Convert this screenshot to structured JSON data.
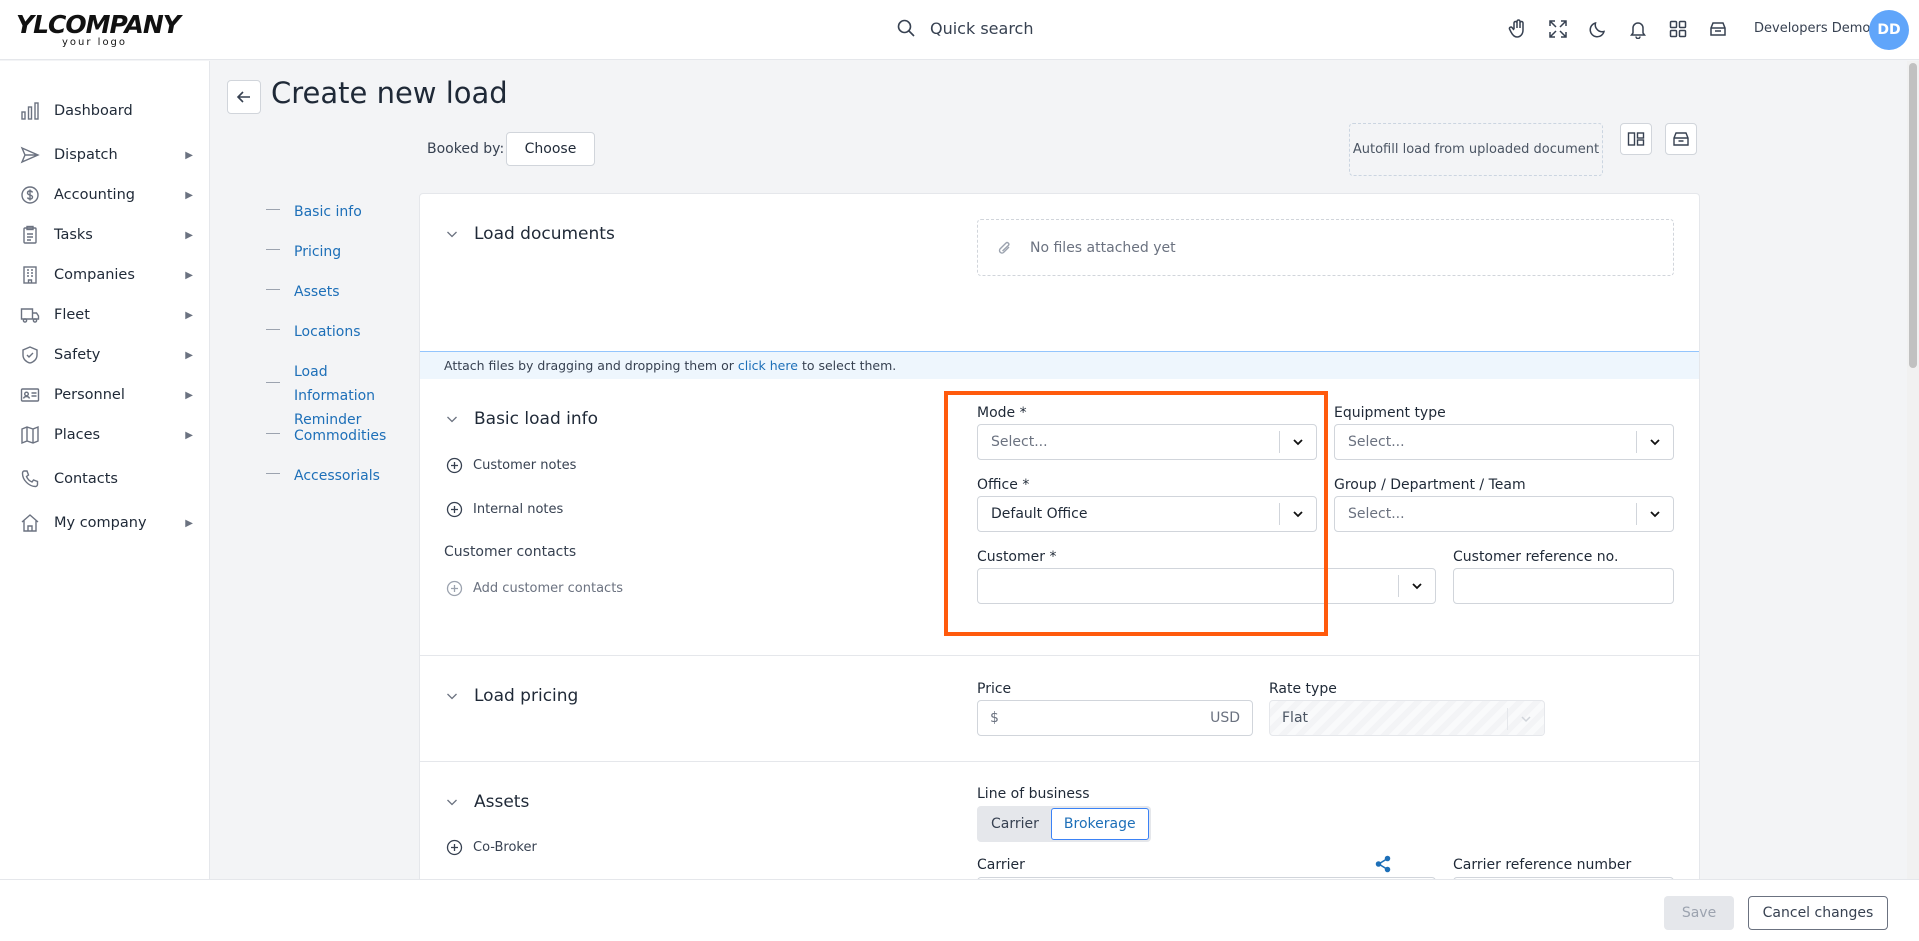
{
  "brand": {
    "logo_main": "YLCOMPANY",
    "logo_sub": "your logo"
  },
  "topbar": {
    "search_label": "Quick search",
    "user_name": "Developers Demo",
    "avatar_initials": "DD",
    "icons": [
      "hand-icon",
      "fullscreen-icon",
      "moon-icon",
      "bell-icon",
      "apps-grid-icon",
      "archive-icon"
    ]
  },
  "sidebar": {
    "items": [
      {
        "label": "Dashboard",
        "icon": "chart-icon",
        "arrow": ""
      },
      {
        "label": "Dispatch",
        "icon": "send-icon",
        "arrow": "▶"
      },
      {
        "label": "Accounting",
        "icon": "dollar-icon",
        "arrow": "▶"
      },
      {
        "label": "Tasks",
        "icon": "clipboard-icon",
        "arrow": "▶"
      },
      {
        "label": "Companies",
        "icon": "building-icon",
        "arrow": "▶"
      },
      {
        "label": "Fleet",
        "icon": "truck-icon",
        "arrow": "▶"
      },
      {
        "label": "Safety",
        "icon": "shield-icon",
        "arrow": "▶"
      },
      {
        "label": "Personnel",
        "icon": "id-card-icon",
        "arrow": "▶"
      },
      {
        "label": "Places",
        "icon": "map-icon",
        "arrow": "▶"
      },
      {
        "label": "Contacts",
        "icon": "phone-icon",
        "arrow": ""
      },
      {
        "label": "My company",
        "icon": "home-icon",
        "arrow": "▶"
      }
    ]
  },
  "page": {
    "title": "Create new load",
    "booked_by_label": "Booked by:",
    "choose_label": "Choose",
    "autofill_label": "Autofill load from uploaded document"
  },
  "anchors": [
    "Basic info",
    "Pricing",
    "Assets",
    "Locations",
    "Load Information Reminder",
    "Commodities",
    "Accessorials"
  ],
  "sections": {
    "documents": {
      "title": "Load documents",
      "no_files": "No files attached yet",
      "attach_prefix": "Attach files by dragging and dropping them or",
      "attach_link": "click here",
      "attach_suffix": "to select them."
    },
    "basic": {
      "title": "Basic load info",
      "customer_notes": "Customer notes",
      "internal_notes": "Internal notes",
      "customer_contacts": "Customer contacts",
      "add_contacts": "Add customer contacts",
      "mode_label": "Mode *",
      "mode_value": "Select...",
      "equipment_label": "Equipment type",
      "equipment_value": "Select...",
      "office_label": "Office *",
      "office_value": "Default Office",
      "group_label": "Group / Department / Team",
      "group_value": "Select...",
      "customer_label": "Customer *",
      "customer_value": "",
      "customer_ref_label": "Customer reference no.",
      "customer_ref_value": ""
    },
    "pricing": {
      "title": "Load pricing",
      "price_label": "Price",
      "price_prefix": "$",
      "price_currency": "USD",
      "rate_label": "Rate type",
      "rate_value": "Flat"
    },
    "assets": {
      "title": "Assets",
      "co_broker": "Co-Broker",
      "lob_label": "Line of business",
      "lob_options": [
        "Carrier",
        "Brokerage"
      ],
      "lob_selected": "Brokerage",
      "carrier_label": "Carrier",
      "carrier_ref_label": "Carrier reference number"
    }
  },
  "footer": {
    "save_label": "Save",
    "cancel_label": "Cancel changes"
  },
  "colors": {
    "accent": "#1d6fb8",
    "highlight": "#ff5a0d",
    "avatar": "#60a5fa"
  }
}
